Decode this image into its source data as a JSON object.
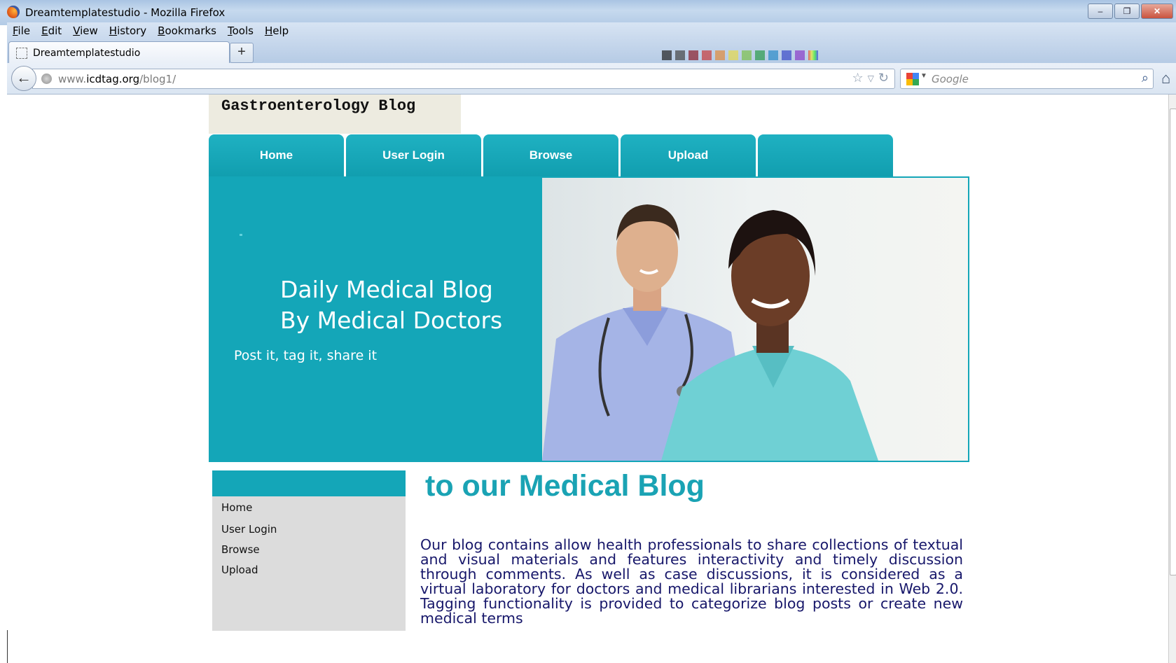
{
  "window": {
    "title": "Dreamtemplatestudio - Mozilla Firefox"
  },
  "menubar": {
    "items": [
      "File",
      "Edit",
      "View",
      "History",
      "Bookmarks",
      "Tools",
      "Help"
    ]
  },
  "tabs": [
    {
      "label": "Dreamtemplatestudio"
    }
  ],
  "newtab_label": "+",
  "navigation": {
    "url_prefix": "www.",
    "url_host": "icdtag.org",
    "url_path": "/blog1/",
    "search_placeholder": "Google"
  },
  "page": {
    "blog_title": "Gastroenterology Blog",
    "main_nav": [
      "Home",
      "User Login",
      "Browse",
      "Upload",
      ""
    ],
    "hero": {
      "heading_line1": "Daily Medical Blog",
      "heading_line2": "By Medical Doctors",
      "tagline": "Post it, tag it, share it"
    },
    "sidebar_links": [
      "Home",
      "User Login",
      "Browse",
      "Upload"
    ],
    "welcome_heading": "to our Medical Blog",
    "intro": "Our blog contains allow health professionals to share collections of textual and visual materials and features  interactivity and timely discussion through comments. As well as case discussions, it is considered as a virtual laboratory for doctors and medical librarians interested in Web 2.0. Tagging functionality is provided to categorize  blog posts or create new medical terms"
  },
  "colors": {
    "accent": "#14a6b8",
    "intro_text": "#17176a",
    "title_box": "#edebe0",
    "sidebar_bg": "#dcdcdc"
  }
}
